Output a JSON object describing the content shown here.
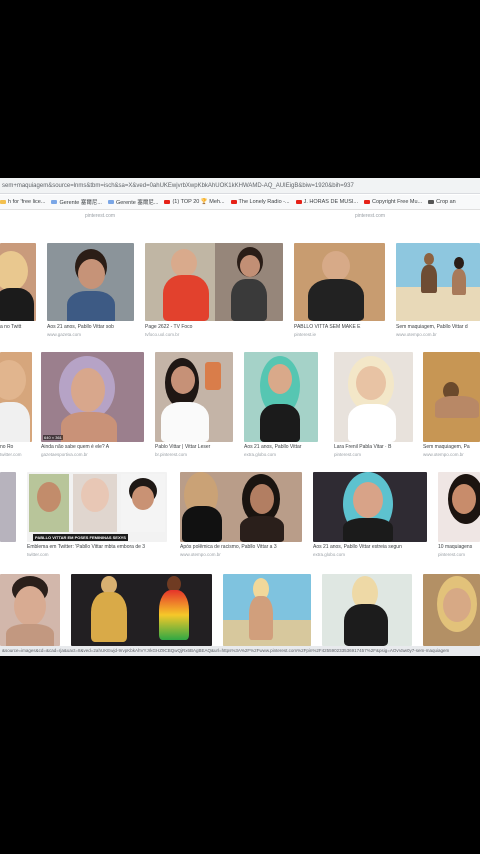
{
  "browser": {
    "url_text": "sem+maquiagem&source=lnms&tbm=isch&sa=X&ved=0ahUKEwjvrbXwpKbkAhUOK1kKHWAMD-AQ_AUIEigB&biw=1920&bih=937",
    "status_url": "&source=images&cd=&cad=rja&uact=8&ved=2ahUKEwjd-9rvpKbkAhVYJrkGHZ9CBQwQjRx6BAgBEAQ&url=https%3A%2F%2Fwww.pinterest.com%2Fpin%2F425590233536917457%2F&psig=AOvVaw0y7-sem-maquiagem"
  },
  "bookmarks": [
    {
      "label": "h for 'free lice...",
      "icon": "folder-icon",
      "color": "#f3c04f"
    },
    {
      "label": "Gerente 塞爾尼...",
      "icon": "bookmark-icon",
      "color": "#7aa6e6"
    },
    {
      "label": "Gerente 塞爾尼...",
      "icon": "bookmark-icon",
      "color": "#7aa6e6"
    },
    {
      "label": "(1) TOP 20 🏆 Meh...",
      "icon": "youtube-icon",
      "color": "#e62117"
    },
    {
      "label": "The Lonely Radio -...",
      "icon": "youtube-icon",
      "color": "#e62117"
    },
    {
      "label": "J. HORAS DE MUSI...",
      "icon": "youtube-icon",
      "color": "#e62117"
    },
    {
      "label": "Copyright Free Mu...",
      "icon": "youtube-icon",
      "color": "#e62117"
    },
    {
      "label": "Crop an",
      "icon": "crop-icon",
      "color": "#555555"
    }
  ],
  "row_sources": [
    "pinterest.com",
    "pinterest.com"
  ],
  "results": [
    {
      "caption": "a no Twitt",
      "source": "twitter.com"
    },
    {
      "caption": "Aos 21 anos, Pabllo Vittar sob",
      "source": "www.gazeta.com"
    },
    {
      "caption": "Page 2622 - TV Foco",
      "source": "tvfoco.uol.com.br"
    },
    {
      "caption": "PABLLO VITTA SEM MAKE E",
      "source": "pinterest.ie"
    },
    {
      "caption": "Sem maquiagem, Pabllo Vittar d",
      "source": "www.otempo.com.br"
    },
    {
      "caption": "no Ro",
      "source": "twitter.com"
    },
    {
      "caption": "Ainda não sabe quem é ele? A",
      "source": "gazetaesportiva.com.br"
    },
    {
      "caption": "Pablo Vittar | Vittar Leser",
      "source": "br.pinterest.com"
    },
    {
      "caption": "Aos 21 anos, Pabllo Vittar",
      "source": "extra.globo.com"
    },
    {
      "caption": "Lara Frenil Pabla Vitar · B",
      "source": "pinterest.com"
    },
    {
      "caption": "Sem maquiagem, Pa",
      "source": "www.otempo.com.br"
    },
    {
      "caption": "Emblema em Twitter: 'Pabllo Vittar mbta embora de 3",
      "source": "twitter.com"
    },
    {
      "caption": "Após polêmica de racismo, Pabllo Vittar a 3",
      "source": "www.otempo.com.br"
    },
    {
      "caption": "Aos 21 anos, Pabllo Vittar estreia segun",
      "source": "extra.globo.com"
    },
    {
      "caption": "10 maquiagens",
      "source": "pinterest.com"
    }
  ],
  "badges": {
    "video_badge": "640 × 361",
    "banner": "PABLLO VITTAR EM POSES FEMININAS SEXYS"
  }
}
